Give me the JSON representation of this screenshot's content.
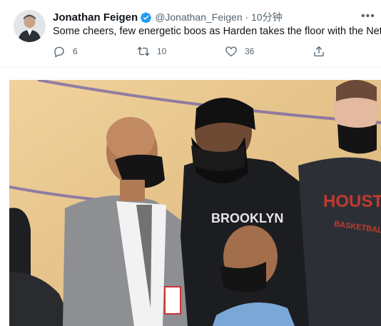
{
  "tweet": {
    "display_name": "Jonathan Feigen",
    "handle_time": "@Jonathan_Feigen · 10分钟",
    "more_label": "•••",
    "text": "Some cheers, few energetic boos as Harden takes the floor with the Nets.",
    "actions": {
      "reply_count": "6",
      "retweet_count": "10",
      "like_count": "36"
    }
  },
  "photo": {
    "jersey_brooklyn": "BROOKLYN",
    "jersey_houston": "HOUSTON",
    "jersey_basketball": "BASKETBALL"
  },
  "colors": {
    "verified": "#1d9bf0",
    "secondary_text": "#536471",
    "court": "#e8c88e"
  },
  "icons": [
    "verified-badge-icon",
    "more-icon",
    "reply-icon",
    "retweet-icon",
    "like-icon",
    "share-icon"
  ]
}
